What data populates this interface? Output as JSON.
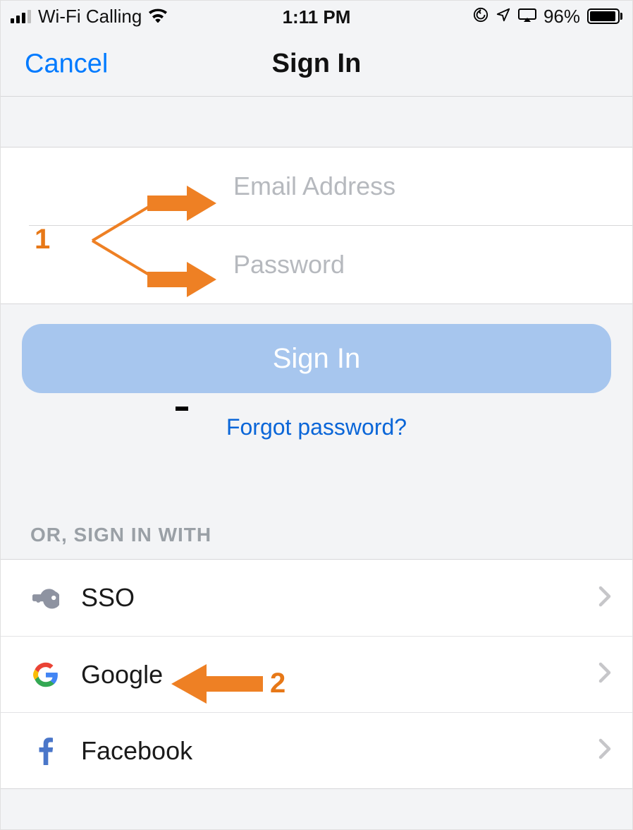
{
  "status": {
    "carrier": "Wi-Fi Calling",
    "time": "1:11 PM",
    "battery_pct": "96%"
  },
  "nav": {
    "cancel": "Cancel",
    "title": "Sign In"
  },
  "form": {
    "email_placeholder": "Email Address",
    "password_placeholder": "Password",
    "signin_label": "Sign In",
    "forgot_label": "Forgot password?"
  },
  "alt": {
    "heading": "OR, SIGN IN WITH",
    "items": [
      {
        "label": "SSO"
      },
      {
        "label": "Google"
      },
      {
        "label": "Facebook"
      }
    ]
  },
  "annotations": {
    "n1": "1",
    "n2": "2"
  }
}
